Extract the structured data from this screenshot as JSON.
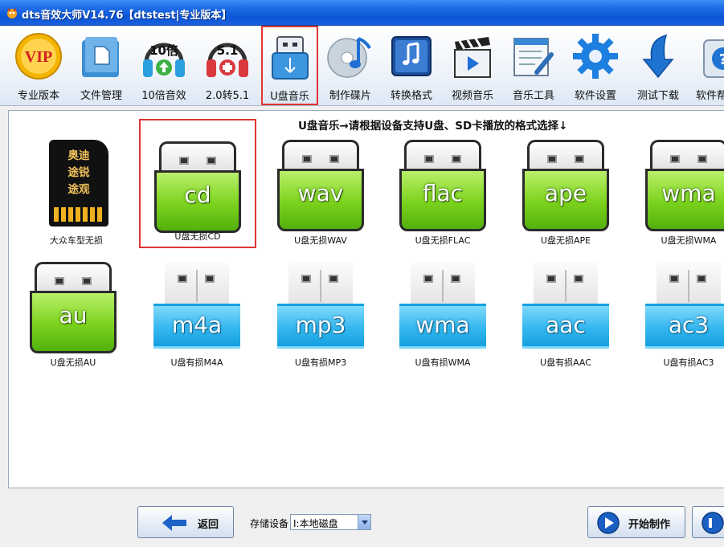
{
  "window": {
    "title": "dts音效大师V14.76【dtstest|专业版本】"
  },
  "toolbar": {
    "items": [
      {
        "label": "专业版本",
        "icon": "vip-badge-icon",
        "icon_text": "VIP"
      },
      {
        "label": "文件管理",
        "icon": "folder-icon"
      },
      {
        "label": "10倍音效",
        "icon": "headphones-10x-icon",
        "icon_text": "10倍"
      },
      {
        "label": "2.0转5.1",
        "icon": "headphones-51-icon",
        "icon_text": "5.1"
      },
      {
        "label": "U盘音乐",
        "icon": "usb-icon"
      },
      {
        "label": "制作碟片",
        "icon": "cd-music-icon"
      },
      {
        "label": "转换格式",
        "icon": "music-note-icon"
      },
      {
        "label": "视频音乐",
        "icon": "clapperboard-icon"
      },
      {
        "label": "音乐工具",
        "icon": "tools-icon"
      },
      {
        "label": "软件设置",
        "icon": "gear-icon"
      },
      {
        "label": "测试下载",
        "icon": "download-arrow-icon"
      },
      {
        "label": "软件帮",
        "icon": "help-icon"
      }
    ]
  },
  "main": {
    "hint": "U盘音乐→请根据设备支持U盘、SD卡播放的格式选择↓",
    "tiles": [
      {
        "caption": "大众车型无损",
        "kind": "sd",
        "text": "奥迪\n途锐\n途观"
      },
      {
        "caption": "U盘无损CD",
        "kind": "green",
        "ext": "cd"
      },
      {
        "caption": "U盘无损WAV",
        "kind": "green",
        "ext": "wav"
      },
      {
        "caption": "U盘无损FLAC",
        "kind": "green",
        "ext": "flac"
      },
      {
        "caption": "U盘无损APE",
        "kind": "green",
        "ext": "ape"
      },
      {
        "caption": "U盘无损WMA",
        "kind": "green",
        "ext": "wma"
      },
      {
        "caption": "U盘无损AU",
        "kind": "green",
        "ext": "au"
      },
      {
        "caption": "U盘有损M4A",
        "kind": "blue",
        "ext": "m4a"
      },
      {
        "caption": "U盘有损MP3",
        "kind": "blue",
        "ext": "mp3"
      },
      {
        "caption": "U盘有损WMA",
        "kind": "blue",
        "ext": "wma"
      },
      {
        "caption": "U盘有损AAC",
        "kind": "blue",
        "ext": "aac"
      },
      {
        "caption": "U盘有损AC3",
        "kind": "blue",
        "ext": "ac3"
      }
    ]
  },
  "bottom": {
    "back_label": "返回",
    "storage_label": "存储设备",
    "storage_value": "I:本地磁盘",
    "start_label": "开始制作"
  },
  "colors": {
    "accent_red": "#e03535",
    "green_usb": "#7bd21d",
    "blue_usb": "#35b7ef",
    "titlebar": "#0b55d6"
  }
}
